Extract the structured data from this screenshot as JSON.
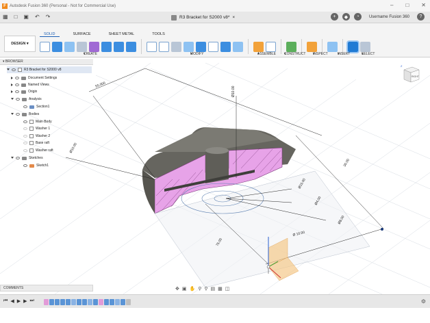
{
  "titlebar": {
    "title": "Autodesk Fusion 360 (Personal - Not for Commercial Use)",
    "logo_letter": "F"
  },
  "doc": {
    "tab_title": "R3 Bracket for S2000 v8*",
    "user": "Username Fusion 360"
  },
  "ribbon": {
    "workspace_tabs": [
      "SOLID",
      "SURFACE",
      "SHEET METAL",
      "TOOLS"
    ],
    "design_label": "DESIGN",
    "groups": {
      "create": "CREATE",
      "modify": "MODIFY",
      "assemble": "ASSEMBLE",
      "construct": "CONSTRUCT",
      "inspect": "INSPECT",
      "insert": "INSERT",
      "select": "SELECT"
    }
  },
  "browser": {
    "header": "BROWSER",
    "root": "R3 Bracket for S2000 v8",
    "items": [
      {
        "label": "Document Settings"
      },
      {
        "label": "Named Views"
      },
      {
        "label": "Origin"
      },
      {
        "label": "Analysis"
      },
      {
        "label": "Section1"
      },
      {
        "label": "Bodies"
      },
      {
        "label": "Main Body"
      },
      {
        "label": "Washer 1"
      },
      {
        "label": "Washer 2"
      },
      {
        "label": "Base raft"
      },
      {
        "label": "Washer raft"
      },
      {
        "label": "Sketches"
      },
      {
        "label": "Sketch1"
      }
    ]
  },
  "comments": {
    "label": "COMMENTS"
  },
  "viewcube": {
    "face": "RIGHT",
    "axis_z": "Z"
  },
  "dimensions": {
    "d1": "55.000",
    "d2": "Ø10.00",
    "d3": "Ø10.00",
    "d4": "30.00",
    "d5": "Ø15.00",
    "d6": "Ø4.00",
    "d7": "Ø8.00",
    "d8": "75.00",
    "d9": "Ø 10.00"
  },
  "colors": {
    "section_fill": "#e7a3e8",
    "body": "#5a5a55",
    "plane": "#f5c98a",
    "accent": "#1a5fb4"
  },
  "icons": [
    "grid-icon",
    "file-icon",
    "save-icon",
    "undo-icon",
    "redo-icon",
    "add-tab-icon",
    "extensions-icon",
    "clock-icon",
    "help-icon",
    "settings-icon"
  ]
}
